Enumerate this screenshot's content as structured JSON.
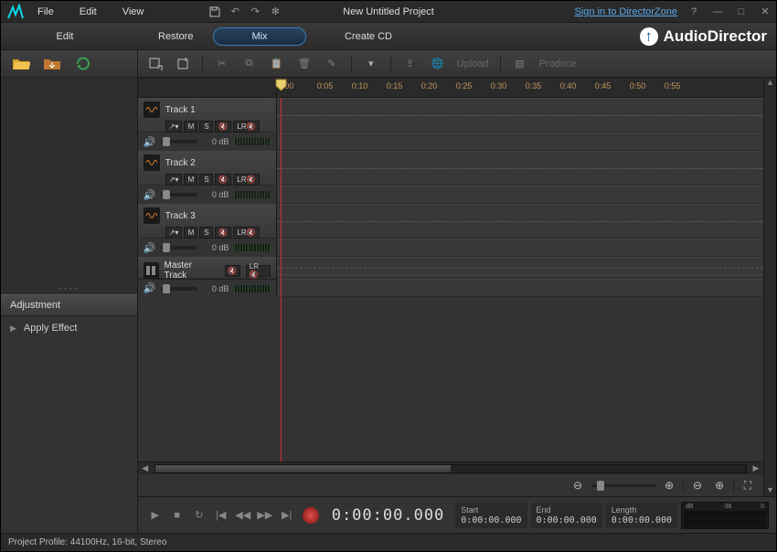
{
  "menubar": {
    "file": "File",
    "edit": "Edit",
    "view": "View"
  },
  "project_name": "New Untitled Project",
  "signin": "Sign in to DirectorZone",
  "modes": {
    "edit": "Edit",
    "restore": "Restore",
    "mix": "Mix",
    "cd": "Create CD"
  },
  "brand": "AudioDirector",
  "toolbar": {
    "upload": "Upload",
    "produce": "Produce"
  },
  "adjustment": {
    "title": "Adjustment",
    "apply": "Apply Effect"
  },
  "ruler": [
    ":00",
    "0:05",
    "0:10",
    "0:15",
    "0:20",
    "0:25",
    "0:30",
    "0:35",
    "0:40",
    "0:45",
    "0:50",
    "0:55"
  ],
  "tracks": [
    {
      "name": "Track 1",
      "db": "0 dB"
    },
    {
      "name": "Track 2",
      "db": "0 dB"
    },
    {
      "name": "Track 3",
      "db": "0 dB"
    }
  ],
  "master": {
    "name": "Master Track",
    "db": "0 dB"
  },
  "btns": {
    "m": "M",
    "s": "S",
    "lr": "LR"
  },
  "transport": {
    "timecode": "0:00:00.000",
    "start_lbl": "Start",
    "start": "0:00:00.000",
    "end_lbl": "End",
    "end": "0:00:00.000",
    "len_lbl": "Length",
    "len": "0:00:00.000"
  },
  "meter": {
    "db": "dB",
    "n36": "-36",
    "zero": "0"
  },
  "status": "Project Profile: 44100Hz, 16-bit, Stereo"
}
